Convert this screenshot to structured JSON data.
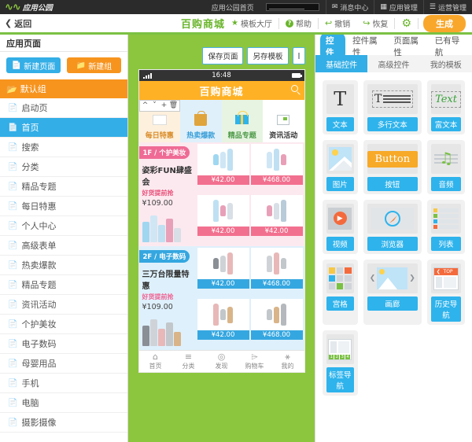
{
  "topbar": {
    "brand": "应用公园",
    "home_link": "应用公园首页",
    "search_value": "",
    "items": [
      {
        "icon": "mail-icon",
        "label": "消息中心"
      },
      {
        "icon": "grid-icon",
        "label": "应用管理"
      },
      {
        "icon": "list-icon",
        "label": "运营管理"
      }
    ]
  },
  "subbar": {
    "back": "返回",
    "app_title": "百购商城",
    "template_hall": "模板大厅",
    "help": "帮助",
    "undo": "撤销",
    "redo": "恢复",
    "settings_icon": "gear-icon",
    "generate": "生成"
  },
  "sidebar": {
    "title": "应用页面",
    "new_page": "新建页面",
    "new_group": "新建组",
    "group": "默认组",
    "pages": [
      {
        "label": "启动页",
        "active": false
      },
      {
        "label": "首页",
        "active": true
      },
      {
        "label": "搜索",
        "active": false
      },
      {
        "label": "分类",
        "active": false
      },
      {
        "label": "精品专题",
        "active": false
      },
      {
        "label": "每日特惠",
        "active": false
      },
      {
        "label": "个人中心",
        "active": false
      },
      {
        "label": "高级表单",
        "active": false
      },
      {
        "label": "热卖爆款",
        "active": false
      },
      {
        "label": "精品专题",
        "active": false
      },
      {
        "label": "资讯活动",
        "active": false
      },
      {
        "label": "个护美妆",
        "active": false
      },
      {
        "label": "电子数码",
        "active": false
      },
      {
        "label": "母婴用品",
        "active": false
      },
      {
        "label": "手机",
        "active": false
      },
      {
        "label": "电脑",
        "active": false
      },
      {
        "label": "摄影摄像",
        "active": false
      }
    ]
  },
  "canvas": {
    "save_page": "保存页面",
    "save_template": "另存模板",
    "preview_icon": "image-icon",
    "float_tools": [
      {
        "icon": "chevron-up-icon",
        "glyph": "⌃"
      },
      {
        "icon": "chevron-down-icon",
        "glyph": "⌄"
      },
      {
        "icon": "plus-icon",
        "glyph": "＋"
      },
      {
        "icon": "trash-icon",
        "glyph": "☐"
      }
    ],
    "phone": {
      "status_time": "16:48",
      "app_header_title": "百购商城",
      "search_icon": "search-icon",
      "categories": [
        {
          "label": "每日特惠",
          "icon": "box-icon"
        },
        {
          "label": "热卖爆款",
          "icon": "bag-icon"
        },
        {
          "label": "精品专题",
          "icon": "gift-icon"
        },
        {
          "label": "资讯活动",
          "icon": "news-icon"
        }
      ],
      "floors": [
        {
          "tag": "1F / 个护美妆",
          "title": "姿彩FUN肆盛会",
          "subtitle": "好货提前抢",
          "price": "¥109.00",
          "cells": [
            {
              "price": "¥42.00"
            },
            {
              "price": "¥468.00"
            },
            {
              "price": "¥42.00"
            },
            {
              "price": "¥42.00"
            }
          ]
        },
        {
          "tag": "2F / 电子数码",
          "title": "三万台限量特惠",
          "subtitle": "好货提前抢",
          "price": "¥109.00",
          "cells": [
            {
              "price": "¥42.00"
            },
            {
              "price": "¥468.00"
            },
            {
              "price": "¥42.00"
            },
            {
              "price": "¥468.00"
            }
          ]
        }
      ],
      "tabbar": [
        {
          "label": "首页",
          "icon": "home-icon",
          "glyph": "⌂"
        },
        {
          "label": "分类",
          "icon": "category-list-icon",
          "glyph": "≡"
        },
        {
          "label": "发现",
          "icon": "compass-icon",
          "glyph": "◎"
        },
        {
          "label": "购物车",
          "icon": "cart-icon",
          "glyph": "⌲"
        },
        {
          "label": "我的",
          "icon": "user-icon",
          "glyph": "⚹"
        }
      ]
    }
  },
  "right_panel": {
    "tabs": [
      {
        "label": "控件",
        "active": true
      },
      {
        "label": "控件属性",
        "active": false
      },
      {
        "label": "页面属性",
        "active": false
      },
      {
        "label": "已有导航",
        "active": false
      }
    ],
    "subtabs": [
      {
        "label": "基础控件",
        "active": true
      },
      {
        "label": "高级控件",
        "active": false
      },
      {
        "label": "我的模板",
        "active": false
      }
    ],
    "widgets": [
      {
        "label": "文本",
        "icon": "text-icon"
      },
      {
        "label": "多行文本",
        "icon": "multiline-text-icon"
      },
      {
        "label": "富文本",
        "icon": "rich-text-icon"
      },
      {
        "label": "图片",
        "icon": "image-icon"
      },
      {
        "label": "按钮",
        "icon": "button-icon"
      },
      {
        "label": "音频",
        "icon": "audio-icon"
      },
      {
        "label": "视频",
        "icon": "video-icon"
      },
      {
        "label": "浏览器",
        "icon": "browser-icon"
      },
      {
        "label": "列表",
        "icon": "list-icon"
      },
      {
        "label": "宫格",
        "icon": "grid-icon"
      },
      {
        "label": "画廊",
        "icon": "gallery-icon"
      },
      {
        "label": "历史导航",
        "icon": "history-nav-icon"
      },
      {
        "label": "标签导航",
        "icon": "tab-nav-icon"
      }
    ],
    "widget_samples": {
      "text_glyph": "T",
      "rich_text": "Text",
      "button": "Button",
      "history_top": "TOP",
      "tab_nums": [
        "1",
        "2",
        "3",
        "4"
      ]
    }
  },
  "colors": {
    "green": "#7bc143",
    "canvas_green": "#8cc63e",
    "blue": "#33aee6",
    "orange": "#f7941e",
    "app_orange": "#ffb125",
    "generate": "#f9a72b"
  }
}
